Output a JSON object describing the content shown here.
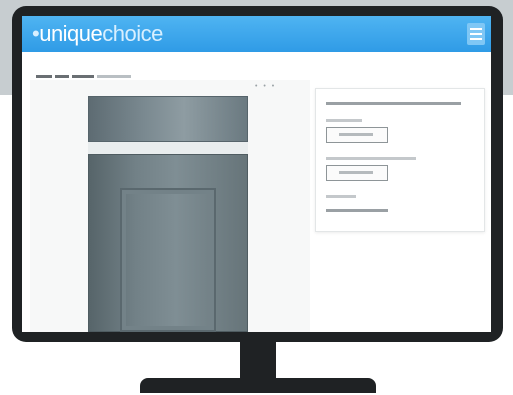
{
  "header": {
    "logo_prefix": "•",
    "logo_strong": "unique",
    "logo_rest": "choice",
    "menu_icon": "hamburger-menu-icon"
  },
  "colors": {
    "header": "#2f9be6",
    "monitor": "#1f2224",
    "door": "#728187"
  }
}
